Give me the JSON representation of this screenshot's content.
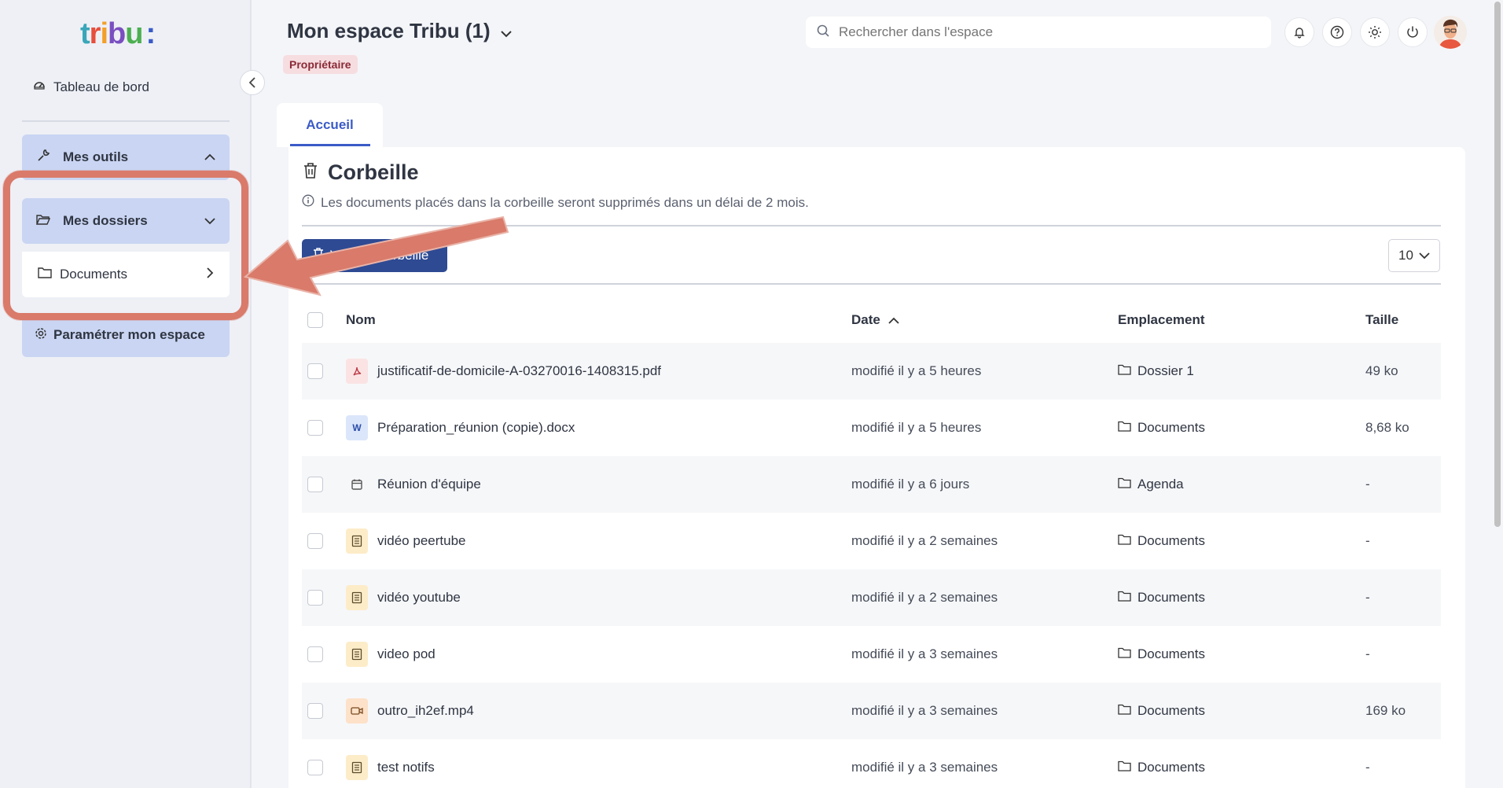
{
  "app": {
    "logo_text": "tribu:",
    "colors": {
      "accent": "#3a5bc7",
      "primary_button": "#2e4a93",
      "sidebar_active": "#c9d5f2",
      "highlight": "#d97a6a",
      "badge_bg": "#f6dde0"
    }
  },
  "sidebar": {
    "dashboard_label": "Tableau de bord",
    "tools_label": "Mes outils",
    "folders_label": "Mes dossiers",
    "documents_label": "Documents",
    "settings_label": "Paramétrer mon espace"
  },
  "header": {
    "space_title": "Mon espace Tribu (1)",
    "role": "Propriétaire",
    "search_placeholder": "Rechercher dans l'espace"
  },
  "tabs": [
    {
      "label": "Accueil",
      "active": true
    }
  ],
  "trash": {
    "title": "Corbeille",
    "info": "Les documents placés dans la corbeille seront supprimés dans un délai de 2 mois.",
    "empty_button": "Vider la corbeille",
    "per_page": "10"
  },
  "table": {
    "columns": {
      "name": "Nom",
      "date": "Date",
      "location": "Emplacement",
      "size": "Taille"
    },
    "rows": [
      {
        "name": "justificatif-de-domicile-A-03270016-1408315.pdf",
        "type": "pdf",
        "date": "modifié il y a 5 heures",
        "location": "Dossier 1",
        "size": "49 ko"
      },
      {
        "name": "Préparation_réunion (copie).docx",
        "type": "doc",
        "date": "modifié il y a 5 heures",
        "location": "Documents",
        "size": "8,68 ko"
      },
      {
        "name": "Réunion d'équipe",
        "type": "event",
        "date": "modifié il y a 6 jours",
        "location": "Agenda",
        "size": "-"
      },
      {
        "name": "vidéo peertube",
        "type": "page",
        "date": "modifié il y a 2 semaines",
        "location": "Documents",
        "size": "-"
      },
      {
        "name": "vidéo youtube",
        "type": "page",
        "date": "modifié il y a 2 semaines",
        "location": "Documents",
        "size": "-"
      },
      {
        "name": "video pod",
        "type": "page",
        "date": "modifié il y a 3 semaines",
        "location": "Documents",
        "size": "-"
      },
      {
        "name": "outro_ih2ef.mp4",
        "type": "video",
        "date": "modifié il y a 3 semaines",
        "location": "Documents",
        "size": "169 ko"
      },
      {
        "name": "test notifs",
        "type": "page",
        "date": "modifié il y a 3 semaines",
        "location": "Documents",
        "size": "-"
      }
    ]
  }
}
